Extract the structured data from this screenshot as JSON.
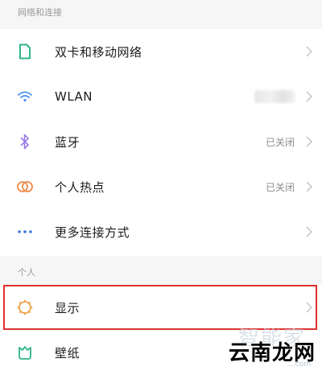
{
  "sections": [
    {
      "header": "网络和连接",
      "items": [
        {
          "label": "双卡和移动网络",
          "icon": "sim-card-icon",
          "status": ""
        },
        {
          "label": "WLAN",
          "icon": "wifi-icon",
          "status": ""
        },
        {
          "label": "蓝牙",
          "icon": "bluetooth-icon",
          "status": "已关闭"
        },
        {
          "label": "个人热点",
          "icon": "hotspot-icon",
          "status": "已关闭"
        },
        {
          "label": "更多连接方式",
          "icon": "more-dots-icon",
          "status": ""
        }
      ]
    },
    {
      "header": "个人",
      "items": [
        {
          "label": "显示",
          "icon": "display-brightness-icon",
          "status": ""
        },
        {
          "label": "壁纸",
          "icon": "wallpaper-icon",
          "status": ""
        }
      ]
    }
  ],
  "watermark": {
    "text": "云南龙网",
    "faint_text": "智能家",
    "sub_text": "…com"
  },
  "colors": {
    "highlight": "#e03030",
    "sim_icon": "#2fb58c",
    "wifi_icon": "#4a8ff0",
    "bluetooth_icon": "#9b7be8",
    "hotspot_icon": "#f08a4b",
    "more_icon": "#3a7bd5",
    "display_icon": "#f0a24b",
    "wallpaper_icon": "#2fb58c"
  }
}
